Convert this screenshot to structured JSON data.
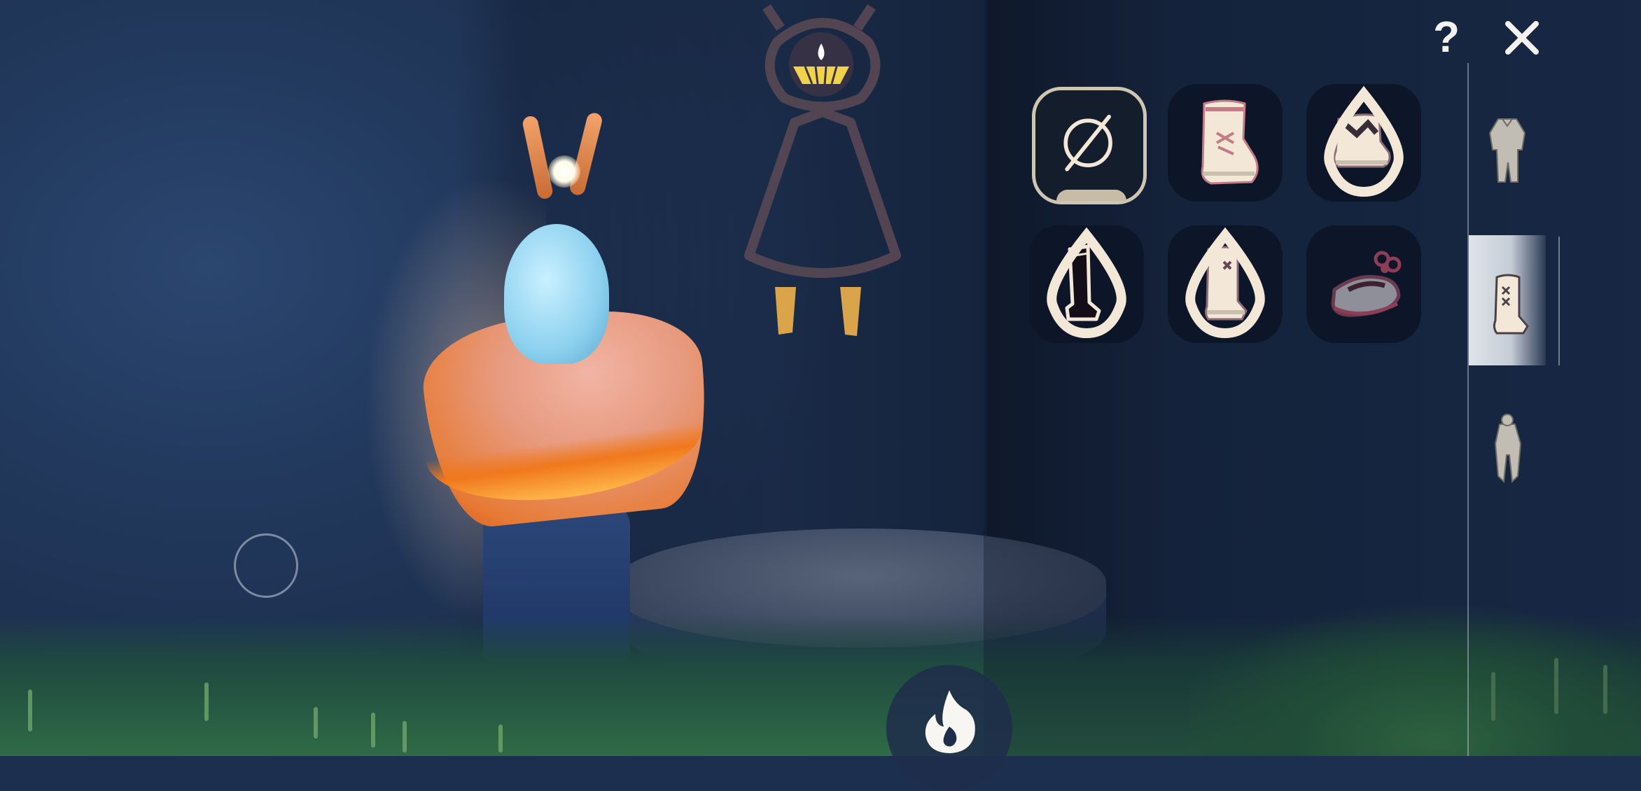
{
  "scene": {
    "description_icon": "player-character",
    "wall_drawing_icon": "cape-silhouette-drawing-icon"
  },
  "toolbar": {
    "help_label": "?",
    "close_icon": "close-icon"
  },
  "wardrobe": {
    "category": "shoes",
    "items": [
      {
        "name": "none",
        "icon": "none-icon",
        "selected": true,
        "cost": false
      },
      {
        "name": "lace-up-boots",
        "icon": "lace-up-boot-icon",
        "selected": false,
        "cost": false
      },
      {
        "name": "ankle-boots",
        "icon": "ankle-boot-icon",
        "selected": false,
        "cost": true
      },
      {
        "name": "tall-boots",
        "icon": "tall-boot-icon",
        "selected": false,
        "cost": true
      },
      {
        "name": "stitched-boots",
        "icon": "stitched-boot-icon",
        "selected": false,
        "cost": true
      },
      {
        "name": "bow-shoes",
        "icon": "bow-shoe-icon",
        "selected": false,
        "cost": false
      }
    ]
  },
  "category_rail": [
    {
      "name": "outfit",
      "icon": "outfit-icon",
      "active": false
    },
    {
      "name": "shoes",
      "icon": "shoe-icon",
      "active": true
    },
    {
      "name": "pants",
      "icon": "pants-icon",
      "active": false
    }
  ],
  "actions": {
    "honk_icon": "flame-icon"
  },
  "colors": {
    "accent_cream": "#f3e7d8",
    "slot_bg": "#0d1628",
    "selected_border": "#cfc6b2"
  }
}
